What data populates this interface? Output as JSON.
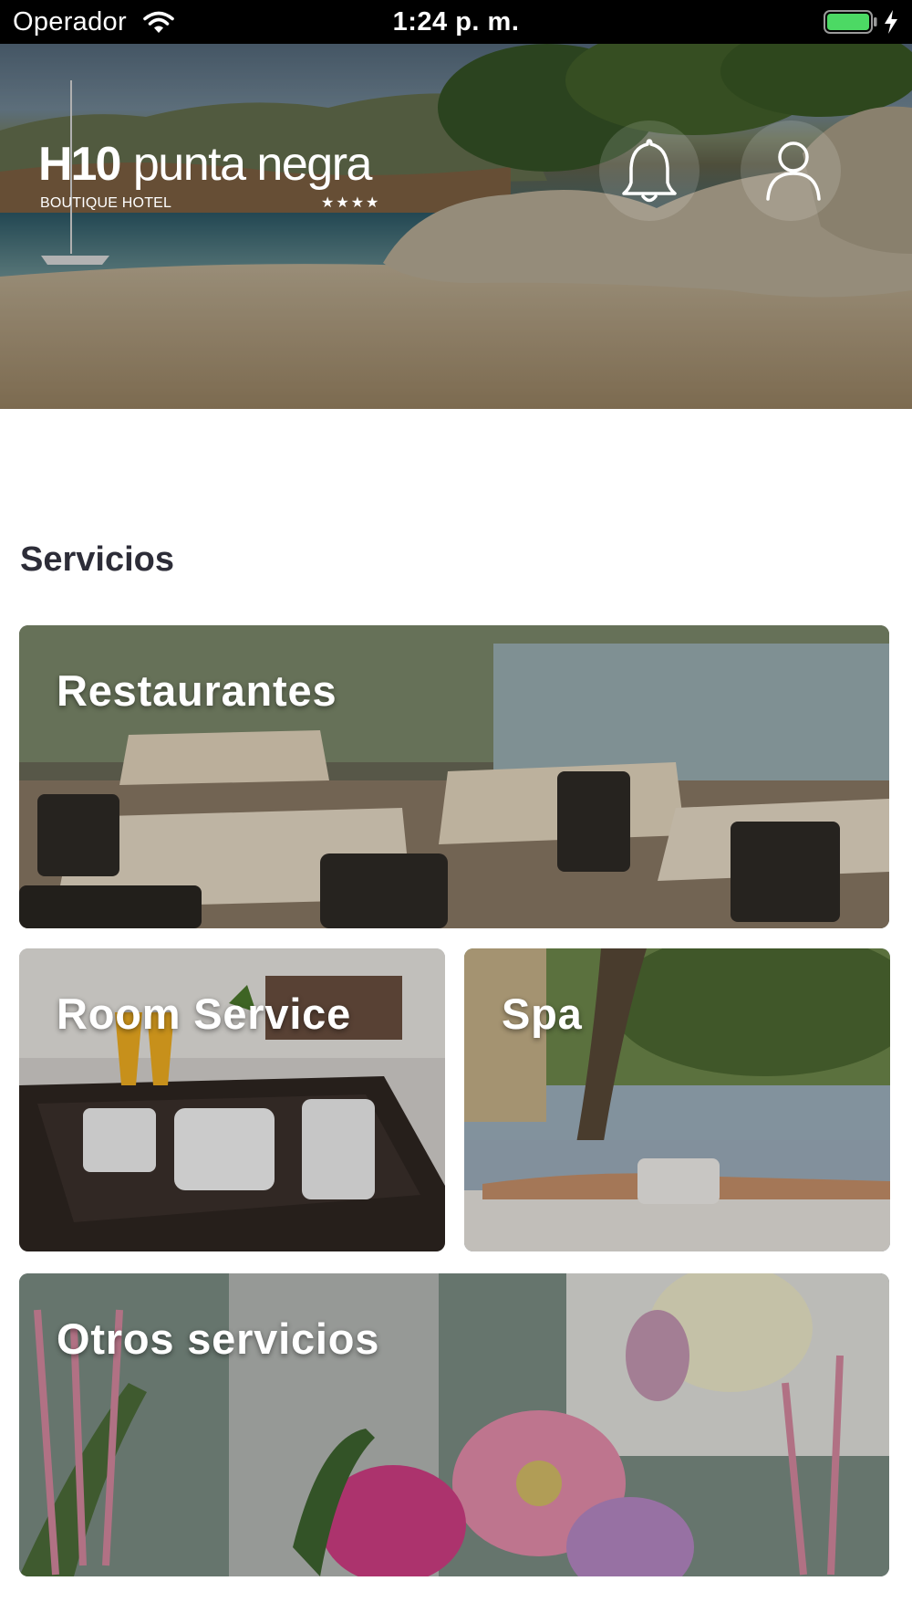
{
  "status_bar": {
    "carrier": "Operador",
    "time": "1:24 p. m.",
    "wifi_icon": "wifi-icon",
    "battery_icon": "battery-icon",
    "charging_icon": "bolt-icon"
  },
  "hero": {
    "logo": {
      "brand": "H10",
      "name": "punta negra",
      "subtitle": "BOUTIQUE HOTEL",
      "stars": "★★★★"
    },
    "notifications_icon": "bell-icon",
    "profile_icon": "user-icon"
  },
  "services": {
    "title": "Servicios",
    "cards": [
      {
        "label": "Restaurantes"
      },
      {
        "label": "Room Service"
      },
      {
        "label": "Spa"
      },
      {
        "label": "Otros servicios"
      }
    ]
  },
  "colors": {
    "status_bar_bg": "#000000",
    "battery_green": "#4cd964",
    "section_title": "#2d2d38",
    "background": "#ffffff"
  }
}
